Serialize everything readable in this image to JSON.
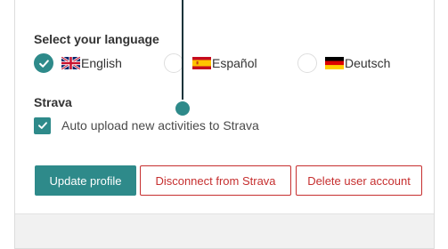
{
  "language": {
    "title": "Select your language",
    "options": [
      {
        "label": "English",
        "flag": "uk-flag-icon",
        "selected": true
      },
      {
        "label": "Español",
        "flag": "spain-flag-icon",
        "selected": false
      },
      {
        "label": "Deutsch",
        "flag": "germany-flag-icon",
        "selected": false
      }
    ]
  },
  "strava": {
    "title": "Strava",
    "auto_upload_label": "Auto upload new activities to Strava",
    "auto_upload_checked": true
  },
  "actions": {
    "update_label": "Update profile",
    "disconnect_label": "Disconnect from Strava",
    "delete_label": "Delete user account"
  },
  "colors": {
    "accent": "#2e8a8a",
    "danger": "#c62f2f",
    "pointer": "#15333a"
  }
}
